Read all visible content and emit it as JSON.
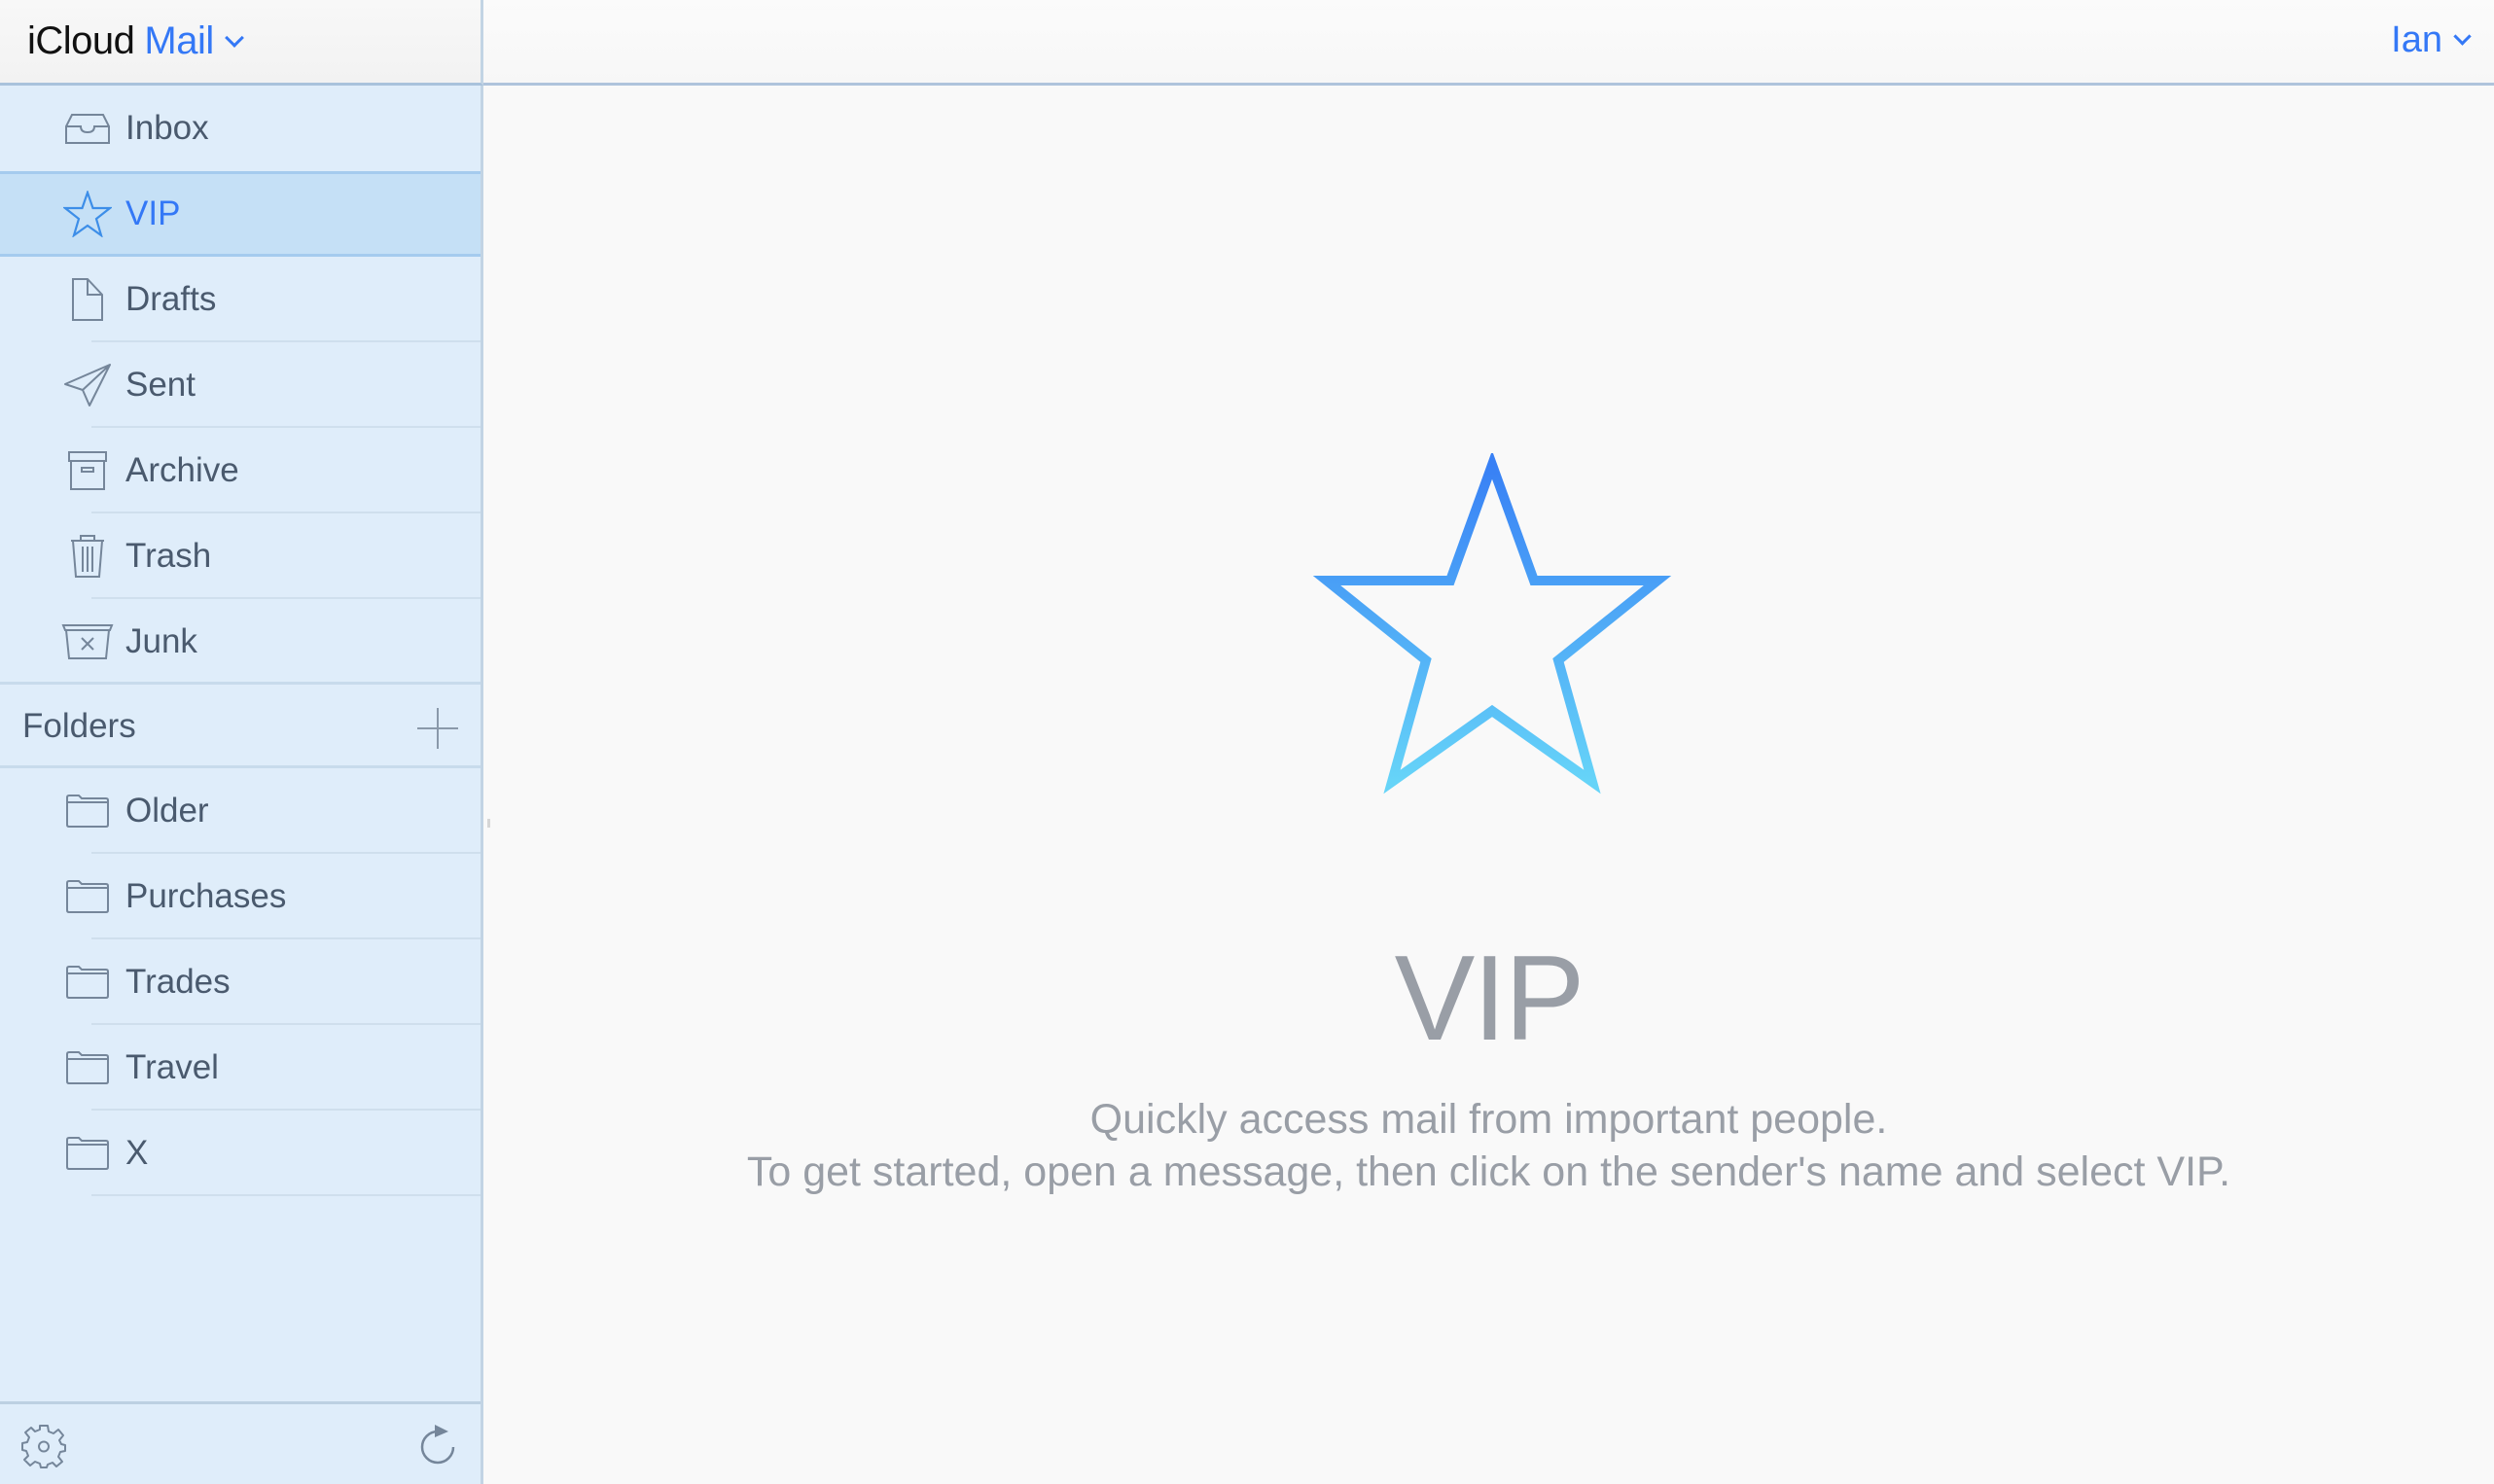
{
  "header": {
    "app_name": "iCloud",
    "app_section": "Mail",
    "user_name": "Ian"
  },
  "sidebar": {
    "mailboxes": [
      {
        "label": "Inbox",
        "icon": "inbox-tray-icon",
        "selected": false
      },
      {
        "label": "VIP",
        "icon": "star-icon",
        "selected": true
      },
      {
        "label": "Drafts",
        "icon": "document-icon",
        "selected": false
      },
      {
        "label": "Sent",
        "icon": "paper-plane-icon",
        "selected": false
      },
      {
        "label": "Archive",
        "icon": "archive-box-icon",
        "selected": false
      },
      {
        "label": "Trash",
        "icon": "trash-icon",
        "selected": false
      },
      {
        "label": "Junk",
        "icon": "junk-bin-icon",
        "selected": false
      }
    ],
    "folders_header": "Folders",
    "folders": [
      {
        "label": "Older",
        "icon": "folder-icon"
      },
      {
        "label": "Purchases",
        "icon": "folder-icon"
      },
      {
        "label": "Trades",
        "icon": "folder-icon"
      },
      {
        "label": "Travel",
        "icon": "folder-icon"
      },
      {
        "label": "X",
        "icon": "folder-icon"
      }
    ],
    "footer": {
      "settings_icon": "gear-icon",
      "refresh_icon": "refresh-icon"
    }
  },
  "main": {
    "empty_state": {
      "icon": "star-icon",
      "title": "VIP",
      "line1": "Quickly access mail from important people.",
      "line2": "To get started, open a message, then click on the sender's name and select VIP."
    }
  },
  "colors": {
    "accent": "#3478f6",
    "sidebar_bg": "#dfedfa",
    "selected_bg": "#c5e0f6",
    "label_text": "#4a5a6e",
    "muted_text": "#999ea6",
    "star_gradient_top": "#3880f5",
    "star_gradient_bottom": "#66d4f8"
  }
}
